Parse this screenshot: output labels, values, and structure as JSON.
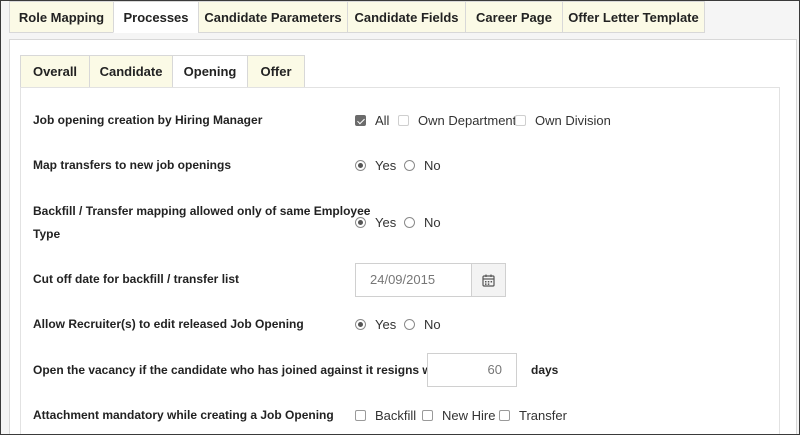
{
  "top_tabs": [
    {
      "label": "Role Mapping",
      "active": false
    },
    {
      "label": "Processes",
      "active": true
    },
    {
      "label": "Candidate Parameters",
      "active": false
    },
    {
      "label": "Candidate Fields",
      "active": false
    },
    {
      "label": "Career Page",
      "active": false
    },
    {
      "label": "Offer Letter Template",
      "active": false
    }
  ],
  "sub_tabs": [
    {
      "label": "Overall",
      "active": false
    },
    {
      "label": "Candidate",
      "active": false
    },
    {
      "label": "Opening",
      "active": true
    },
    {
      "label": "Offer",
      "active": false
    }
  ],
  "settings": {
    "hiring_manager": {
      "label": "Job opening creation by Hiring Manager",
      "options": [
        {
          "label": "All",
          "checked": true
        },
        {
          "label": "Own Department",
          "checked": false
        },
        {
          "label": "Own Division",
          "checked": false
        }
      ]
    },
    "map_transfers": {
      "label": "Map transfers to new job openings",
      "options": [
        {
          "label": "Yes",
          "selected": true
        },
        {
          "label": "No",
          "selected": false
        }
      ]
    },
    "backfill_mapping": {
      "label_line1": "Backfill / Transfer mapping allowed only of same Employee",
      "label_line2": "Type",
      "options": [
        {
          "label": "Yes",
          "selected": true
        },
        {
          "label": "No",
          "selected": false
        }
      ]
    },
    "cutoff_date": {
      "label": "Cut off date for backfill / transfer list",
      "value": "24/09/2015"
    },
    "recruiter_edit": {
      "label": "Allow Recruiter(s) to edit released Job Opening",
      "options": [
        {
          "label": "Yes",
          "selected": true
        },
        {
          "label": "No",
          "selected": false
        }
      ]
    },
    "open_vacancy": {
      "label": "Open the vacancy if the candidate who has joined against it resigns within",
      "value": "60",
      "suffix": "days"
    },
    "attachment": {
      "label": "Attachment mandatory while creating a Job Opening",
      "options": [
        {
          "label": "Backfill",
          "checked": false
        },
        {
          "label": "New Hire",
          "checked": false
        },
        {
          "label": "Transfer",
          "checked": false
        }
      ]
    }
  },
  "icons": {
    "calendar": "calendar-icon"
  },
  "colors": {
    "tab_bg": "#fbfae6",
    "border": "#d8d8d8"
  }
}
